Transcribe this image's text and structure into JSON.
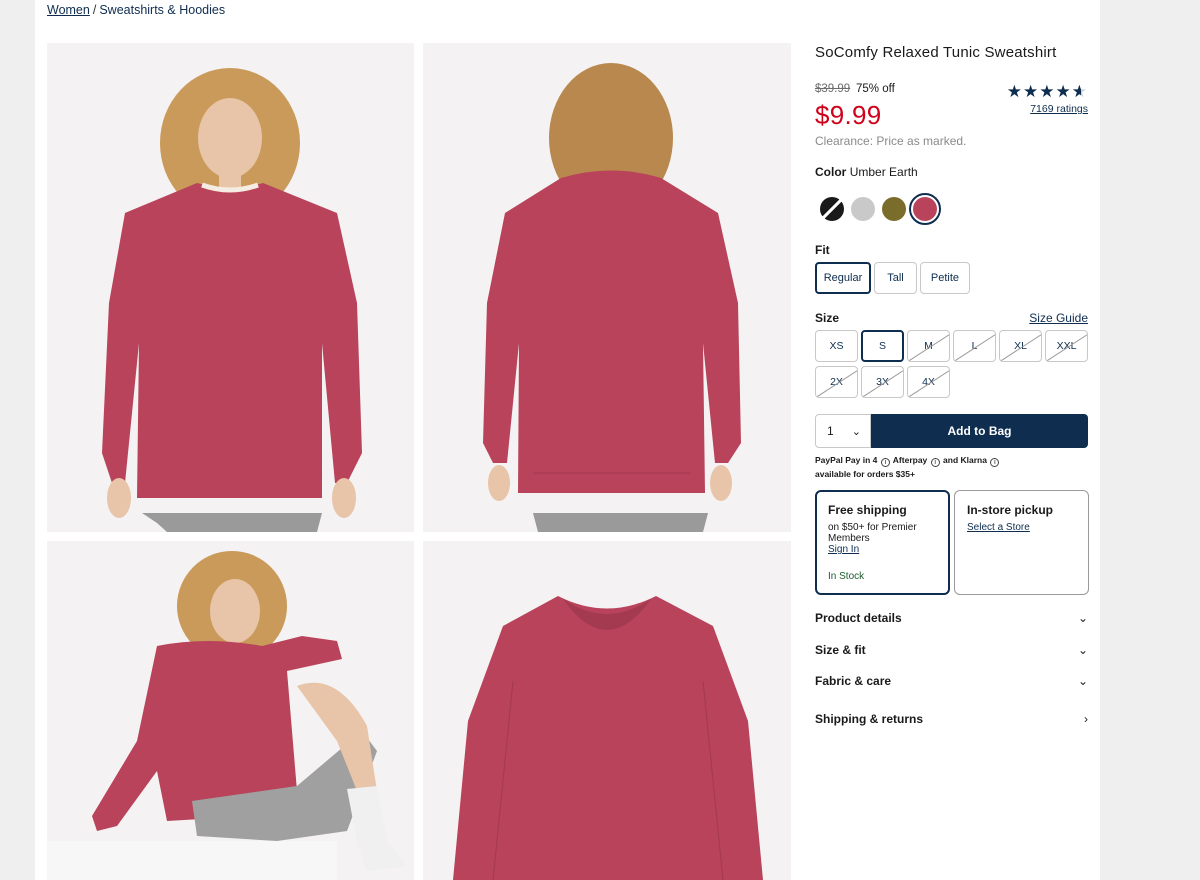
{
  "breadcrumb": {
    "level1": "Women",
    "separator": "/",
    "level2": "Sweatshirts & Hoodies"
  },
  "gallery": {
    "images": [
      {
        "alt": "front view",
        "color": "#b8435a"
      },
      {
        "alt": "back view",
        "color": "#b8435a"
      },
      {
        "alt": "seated pose",
        "color": "#b8435a"
      },
      {
        "alt": "flat lay",
        "color": "#b8435a"
      }
    ]
  },
  "product": {
    "title": "SoComfy Relaxed Tunic Sweatshirt",
    "original_price": "$39.99",
    "discount": "75% off",
    "price": "$9.99",
    "clearance_note": "Clearance: Price as marked.",
    "rating_stars": 4.5,
    "ratings_label": "7169 ratings"
  },
  "color": {
    "label": "Color",
    "selected_name": "Umber Earth",
    "swatches": [
      {
        "name": "black",
        "hex": "#1a1a1a"
      },
      {
        "name": "light gray",
        "hex": "#c9c9c9"
      },
      {
        "name": "olive",
        "hex": "#7a6d2c"
      },
      {
        "name": "umber earth",
        "hex": "#b8435a"
      }
    ]
  },
  "fit": {
    "label": "Fit",
    "options": [
      "Regular",
      "Tall",
      "Petite"
    ],
    "selected": "Regular"
  },
  "size": {
    "label": "Size",
    "guide_label": "Size Guide",
    "options": [
      "XS",
      "S",
      "M",
      "L",
      "XL",
      "XXL",
      "2X",
      "3X",
      "4X"
    ],
    "selected": "S",
    "out_of_stock": [
      "M",
      "L",
      "XL",
      "XXL",
      "2X",
      "3X",
      "4X"
    ]
  },
  "cart": {
    "quantity": "1",
    "add_label": "Add to Bag"
  },
  "paylater": {
    "line1_a": "PayPal Pay in 4",
    "line1_b": "Afterpay",
    "line1_c": "and Klarna",
    "line2": "available for orders $35+",
    "info_glyph": "i"
  },
  "shipping": {
    "title": "Free shipping",
    "text": "on $50+ for Premier Members",
    "link": "Sign In",
    "stock": "In Stock"
  },
  "pickup": {
    "title": "In-store pickup",
    "link": "Select a Store"
  },
  "accordions": {
    "details": "Product details",
    "size_fit": "Size & fit",
    "fabric": "Fabric & care",
    "shipping": "Shipping & returns"
  },
  "icons": {
    "chevron_down": "⌄",
    "chevron_right": "›",
    "star": "★"
  }
}
